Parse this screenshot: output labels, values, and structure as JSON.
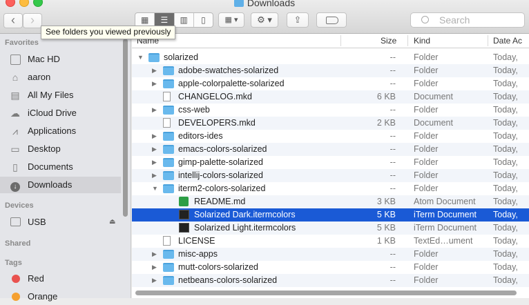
{
  "window": {
    "title": "Downloads"
  },
  "toolbar": {
    "back_glyph": "‹",
    "forward_glyph": "›",
    "search_placeholder": "Search",
    "tooltip": "See folders you viewed previously",
    "view_modes": [
      "icon-view",
      "list-view",
      "column-view",
      "cover-flow-view"
    ],
    "selected_view": "list-view"
  },
  "sidebar": {
    "favorites_header": "Favorites",
    "favorites": [
      {
        "label": "Mac HD",
        "icon": "hard-drive-icon"
      },
      {
        "label": "aaron",
        "icon": "home-icon"
      },
      {
        "label": "All My Files",
        "icon": "all-files-icon"
      },
      {
        "label": "iCloud Drive",
        "icon": "cloud-icon"
      },
      {
        "label": "Applications",
        "icon": "applications-icon"
      },
      {
        "label": "Desktop",
        "icon": "desktop-icon"
      },
      {
        "label": "Documents",
        "icon": "documents-icon"
      },
      {
        "label": "Downloads",
        "icon": "downloads-icon",
        "selected": true
      }
    ],
    "devices_header": "Devices",
    "devices": [
      {
        "label": "USB",
        "icon": "usb-drive-icon"
      }
    ],
    "shared_header": "Shared",
    "tags_header": "Tags",
    "tags": [
      {
        "label": "Red",
        "color": "#e9524f"
      },
      {
        "label": "Orange",
        "color": "#f5a030"
      }
    ]
  },
  "columns": {
    "name": "Name",
    "size": "Size",
    "kind": "Kind",
    "date": "Date Ac"
  },
  "rows": [
    {
      "name": "solarized",
      "size": "--",
      "kind": "Folder",
      "date": "Today,",
      "icon": "folder",
      "depth": 0,
      "disclosure": "▼"
    },
    {
      "name": "adobe-swatches-solarized",
      "size": "--",
      "kind": "Folder",
      "date": "Today,",
      "icon": "folder",
      "depth": 1,
      "disclosure": "▶"
    },
    {
      "name": "apple-colorpalette-solarized",
      "size": "--",
      "kind": "Folder",
      "date": "Today,",
      "icon": "folder",
      "depth": 1,
      "disclosure": "▶"
    },
    {
      "name": "CHANGELOG.mkd",
      "size": "6 KB",
      "kind": "Document",
      "date": "Today,",
      "icon": "doc",
      "depth": 1,
      "disclosure": ""
    },
    {
      "name": "css-web",
      "size": "--",
      "kind": "Folder",
      "date": "Today,",
      "icon": "folder",
      "depth": 1,
      "disclosure": "▶"
    },
    {
      "name": "DEVELOPERS.mkd",
      "size": "2 KB",
      "kind": "Document",
      "date": "Today,",
      "icon": "doc",
      "depth": 1,
      "disclosure": ""
    },
    {
      "name": "editors-ides",
      "size": "--",
      "kind": "Folder",
      "date": "Today,",
      "icon": "folder",
      "depth": 1,
      "disclosure": "▶"
    },
    {
      "name": "emacs-colors-solarized",
      "size": "--",
      "kind": "Folder",
      "date": "Today,",
      "icon": "folder",
      "depth": 1,
      "disclosure": "▶"
    },
    {
      "name": "gimp-palette-solarized",
      "size": "--",
      "kind": "Folder",
      "date": "Today,",
      "icon": "folder",
      "depth": 1,
      "disclosure": "▶"
    },
    {
      "name": "intellij-colors-solarized",
      "size": "--",
      "kind": "Folder",
      "date": "Today,",
      "icon": "folder",
      "depth": 1,
      "disclosure": "▶"
    },
    {
      "name": "iterm2-colors-solarized",
      "size": "--",
      "kind": "Folder",
      "date": "Today,",
      "icon": "folder",
      "depth": 1,
      "disclosure": "▼"
    },
    {
      "name": "README.md",
      "size": "3 KB",
      "kind": "Atom Document",
      "date": "Today,",
      "icon": "md",
      "depth": 2,
      "disclosure": ""
    },
    {
      "name": "Solarized Dark.itermcolors",
      "size": "5 KB",
      "kind": "iTerm Document",
      "date": "Today,",
      "icon": "term",
      "depth": 2,
      "disclosure": "",
      "selected": true
    },
    {
      "name": "Solarized Light.itermcolors",
      "size": "5 KB",
      "kind": "iTerm Document",
      "date": "Today,",
      "icon": "term",
      "depth": 2,
      "disclosure": ""
    },
    {
      "name": "LICENSE",
      "size": "1 KB",
      "kind": "TextEd…ument",
      "date": "Today,",
      "icon": "doc",
      "depth": 1,
      "disclosure": ""
    },
    {
      "name": "misc-apps",
      "size": "--",
      "kind": "Folder",
      "date": "Today,",
      "icon": "folder",
      "depth": 1,
      "disclosure": "▶"
    },
    {
      "name": "mutt-colors-solarized",
      "size": "--",
      "kind": "Folder",
      "date": "Today,",
      "icon": "folder",
      "depth": 1,
      "disclosure": "▶"
    },
    {
      "name": "netbeans-colors-solarized",
      "size": "--",
      "kind": "Folder",
      "date": "Today,",
      "icon": "folder",
      "depth": 1,
      "disclosure": "▶"
    }
  ],
  "colors": {
    "selection": "#1a5ad6",
    "folder": "#69b9ed"
  }
}
